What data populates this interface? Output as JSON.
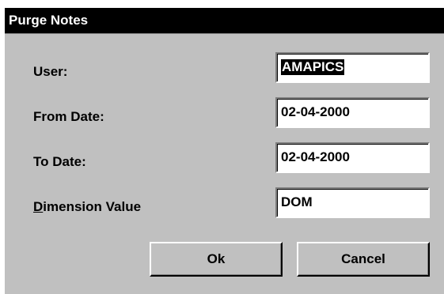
{
  "dialog": {
    "title": "Purge Notes",
    "colors": {
      "face": "#c0c0c0",
      "titlebar": "#000000",
      "title_text": "#ffffff"
    }
  },
  "fields": {
    "user": {
      "label": "User:",
      "value": "AMAPICS",
      "selected": true
    },
    "from_date": {
      "label": "From Date:",
      "value": "02-04-2000"
    },
    "to_date": {
      "label": "To Date:",
      "value": "02-04-2000"
    },
    "dimension_value": {
      "label_mnemonic": "D",
      "label_rest": "imension Value",
      "value": "DOM"
    }
  },
  "buttons": {
    "ok_label": "Ok",
    "cancel_label": "Cancel"
  }
}
